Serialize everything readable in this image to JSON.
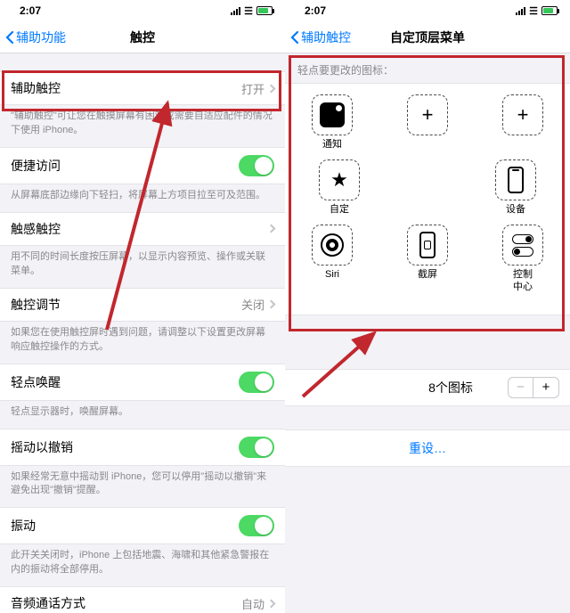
{
  "statusbar": {
    "time": "2:07"
  },
  "left": {
    "back": "辅助功能",
    "title": "触控",
    "rows": [
      {
        "label": "辅助触控",
        "value": "打开",
        "footer": "\"辅助触控\"可让您在触摸屏幕有困难或需要自适应配件的情况下使用 iPhone。"
      },
      {
        "label": "便捷访问",
        "footer": "从屏幕底部边缘向下轻扫，将屏幕上方项目拉至可及范围。"
      },
      {
        "label": "触感触控",
        "footer": "用不同的时间长度按压屏幕，以显示内容预览、操作或关联菜单。"
      },
      {
        "label": "触控调节",
        "value": "关闭",
        "footer": "如果您在使用触控屏时遇到问题，请调整以下设置更改屏幕响应触控操作的方式。"
      },
      {
        "label": "轻点唤醒",
        "footer": "轻点显示器时，唤醒屏幕。"
      },
      {
        "label": "摇动以撤销",
        "footer": "如果经常无意中摇动到 iPhone，您可以停用\"摇动以撤销\"来避免出现\"撤销\"提醒。"
      },
      {
        "label": "振动",
        "footer": "此开关关闭时，iPhone 上包括地震、海啸和其他紧急警报在内的振动将全部停用。"
      },
      {
        "label": "音频通话方式",
        "value": "自动"
      }
    ]
  },
  "right": {
    "back": "辅助触控",
    "title": "自定顶层菜单",
    "hint": "轻点要更改的图标：",
    "slots": {
      "notif": "通知",
      "custom": "自定",
      "device": "设备",
      "siri": "Siri",
      "screenshot": "截屏",
      "control": "控制\n中心"
    },
    "count_label": "8个图标",
    "reset": "重设…"
  }
}
